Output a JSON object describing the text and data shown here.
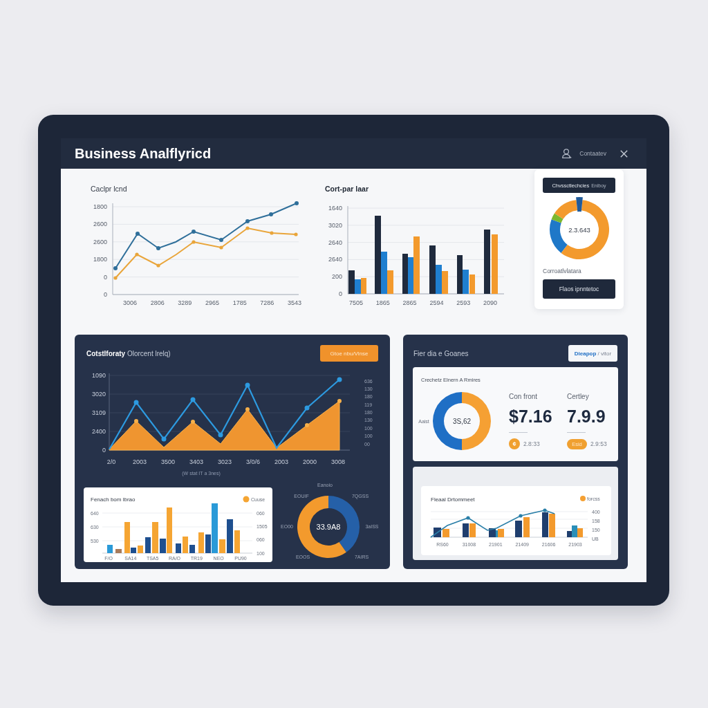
{
  "window": {
    "title": "Business Analflyricd",
    "user_name": "Contaatev"
  },
  "line_chart": {
    "title": "Caclpr lcnd",
    "y_labels": [
      "1800",
      "2600",
      "2600",
      "1800",
      "0",
      "0"
    ],
    "x_labels": [
      "3006",
      "2806",
      "3289",
      "2965",
      "1785",
      "7286",
      "3543"
    ]
  },
  "bar_chart": {
    "title": "Cort-par laar",
    "y_labels": [
      "1640",
      "3020",
      "2640",
      "2640",
      "200",
      "0"
    ],
    "x_labels": [
      "7505",
      "1865",
      "2865",
      "2594",
      "2593",
      "2090"
    ]
  },
  "summary_card": {
    "tag": "Chvssctlechcies",
    "tag_note": "Eniboy",
    "donut_value": "2.3.643",
    "caption": "Corroatlvlatara",
    "button": "Flaos ipnntetoc"
  },
  "trend_panel": {
    "title": "**Cotstlforaty** Olorcent lrelq)",
    "button": "Gtoe nbu/Vinse",
    "y_labels": [
      "1090",
      "3020",
      "3109",
      "2400",
      "0"
    ],
    "right_labels": [
      "636",
      "130",
      "180",
      "119",
      "180",
      "130",
      "100",
      "100",
      "00"
    ],
    "x_labels": [
      "2/0",
      "2003",
      "3500",
      "3403",
      "3023",
      "3/0/6",
      "2003",
      "2000",
      "3008"
    ],
    "subtitle": "(W stat IT a 3nes)",
    "bar_card": {
      "title": "Fenach bom lbrao",
      "legend": "Cuuse",
      "y_labels": [
        "640",
        "630",
        "530"
      ],
      "right_labels": [
        "060",
        "1505",
        "060",
        "100"
      ],
      "x_labels": [
        "F/O",
        "SA14",
        "TSA5",
        "RA/O",
        "TR19",
        "NEO",
        "PU90"
      ]
    },
    "donut": {
      "value": "33.9A8",
      "labels": [
        "Eanoio",
        "EOUIF",
        "7QGSS",
        "EO00",
        "3aISS",
        "EOOS",
        "7AIRS"
      ]
    }
  },
  "overview_panel": {
    "title": "Fier dia e Goanes",
    "button": "**Dieapop** / vitor",
    "donut_card": {
      "title": "Crechetz Elnern A Rmires",
      "donut_value": "3S,62",
      "donut_label": "Aaist",
      "metrics": [
        {
          "label": "Con front",
          "value": "$7.16",
          "badge": {
            "kind": "coin",
            "text": "¢"
          },
          "note": "2.8:33"
        },
        {
          "label": "Certley",
          "value": "7.9.9",
          "badge": {
            "kind": "pill",
            "text": "Esid"
          },
          "note": "2.9:53"
        }
      ]
    },
    "combo_card": {
      "title": "Fleaal Drtommeet",
      "legend": "forcss",
      "right_labels": [
        "400",
        "158",
        "150",
        "UB"
      ],
      "x_labels": [
        "RS60",
        "31008",
        "21901",
        "21409",
        "21606",
        "21903"
      ]
    }
  }
}
